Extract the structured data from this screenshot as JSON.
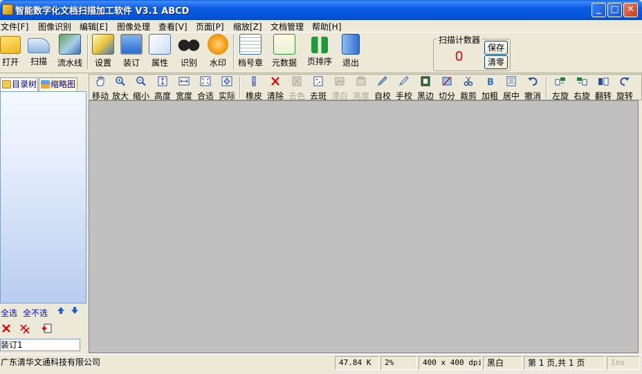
{
  "window": {
    "title": "智能数字化文档扫描加工软件 V3.1 ABCD"
  },
  "menu": [
    "文件[F]",
    "图像识别",
    "编辑[E]",
    "图像处理",
    "查看[V]",
    "页面[P]",
    "缩放[Z]",
    "文档管理",
    "帮助[H]"
  ],
  "toolbar1": {
    "open": "打开",
    "scan": "扫描",
    "pipeline": "流水线",
    "settings": "设置",
    "bind": "装订",
    "properties": "属性",
    "recognize": "识别",
    "watermark": "水印",
    "archive_stamp": "档号章",
    "metadata": "元数据",
    "page_sort": "页排序",
    "exit": "退出"
  },
  "counter": {
    "title": "扫描计数器",
    "value": "0",
    "save": "保存",
    "clear": "清零"
  },
  "left_panel": {
    "tab_tree": "目录树",
    "tab_thumbs": "缩略图",
    "select_all": "全选",
    "select_none": "全不选",
    "binding_value": "装订1"
  },
  "toolbar2": {
    "move": "移动",
    "zoom_in": "放大",
    "zoom_out": "缩小",
    "height": "高度",
    "width": "宽度",
    "fit": "合适",
    "actual": "实际",
    "eraser": "橡皮",
    "clear": "清除",
    "decolor": "去色",
    "despeckle": "去斑",
    "whiten": "漂白",
    "brightness": "亮度",
    "auto_deskew": "自校",
    "manual_deskew": "手校",
    "black_border": "黑边",
    "split": "切分",
    "crop": "裁剪",
    "bold": "加粗",
    "center": "居中",
    "undo": "撤消",
    "rotate_left": "左旋",
    "rotate_right": "右旋",
    "flip": "翻转",
    "rotate": "旋转"
  },
  "status": {
    "company": "广东清华文通科技有限公司",
    "file_size": "47.84 K",
    "zoom": "2%",
    "resolution": "400 x 400 dpi",
    "color_mode": "黑白",
    "page_info": "第 1 页,共 1 页",
    "ins": "Ins"
  }
}
